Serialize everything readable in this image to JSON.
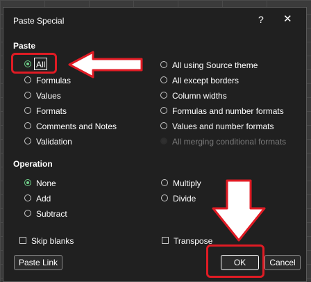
{
  "dialog": {
    "title": "Paste Special",
    "help_label": "?",
    "close_label": "✕"
  },
  "paste": {
    "heading": "Paste",
    "left_options": [
      {
        "label": "All",
        "checked": true
      },
      {
        "label": "Formulas",
        "checked": false
      },
      {
        "label": "Values",
        "checked": false
      },
      {
        "label": "Formats",
        "checked": false
      },
      {
        "label": "Comments and Notes",
        "checked": false
      },
      {
        "label": "Validation",
        "checked": false
      }
    ],
    "right_options": [
      {
        "label": "All using Source theme",
        "checked": false,
        "disabled": false
      },
      {
        "label": "All except borders",
        "checked": false,
        "disabled": false
      },
      {
        "label": "Column widths",
        "checked": false,
        "disabled": false
      },
      {
        "label": "Formulas and number formats",
        "checked": false,
        "disabled": false
      },
      {
        "label": "Values and number formats",
        "checked": false,
        "disabled": false
      },
      {
        "label": "All merging conditional formats",
        "checked": false,
        "disabled": true
      }
    ]
  },
  "operation": {
    "heading": "Operation",
    "left_options": [
      {
        "label": "None",
        "checked": true
      },
      {
        "label": "Add",
        "checked": false
      },
      {
        "label": "Subtract",
        "checked": false
      }
    ],
    "right_options": [
      {
        "label": "Multiply",
        "checked": false
      },
      {
        "label": "Divide",
        "checked": false
      }
    ]
  },
  "checkboxes": {
    "skip_blanks": "Skip blanks",
    "transpose": "Transpose"
  },
  "buttons": {
    "paste_link": "Paste Link",
    "ok": "OK",
    "cancel": "Cancel"
  },
  "colors": {
    "accent_radio": "#6fd08a",
    "annotation_red": "#e01b24",
    "dialog_bg": "#202020"
  }
}
